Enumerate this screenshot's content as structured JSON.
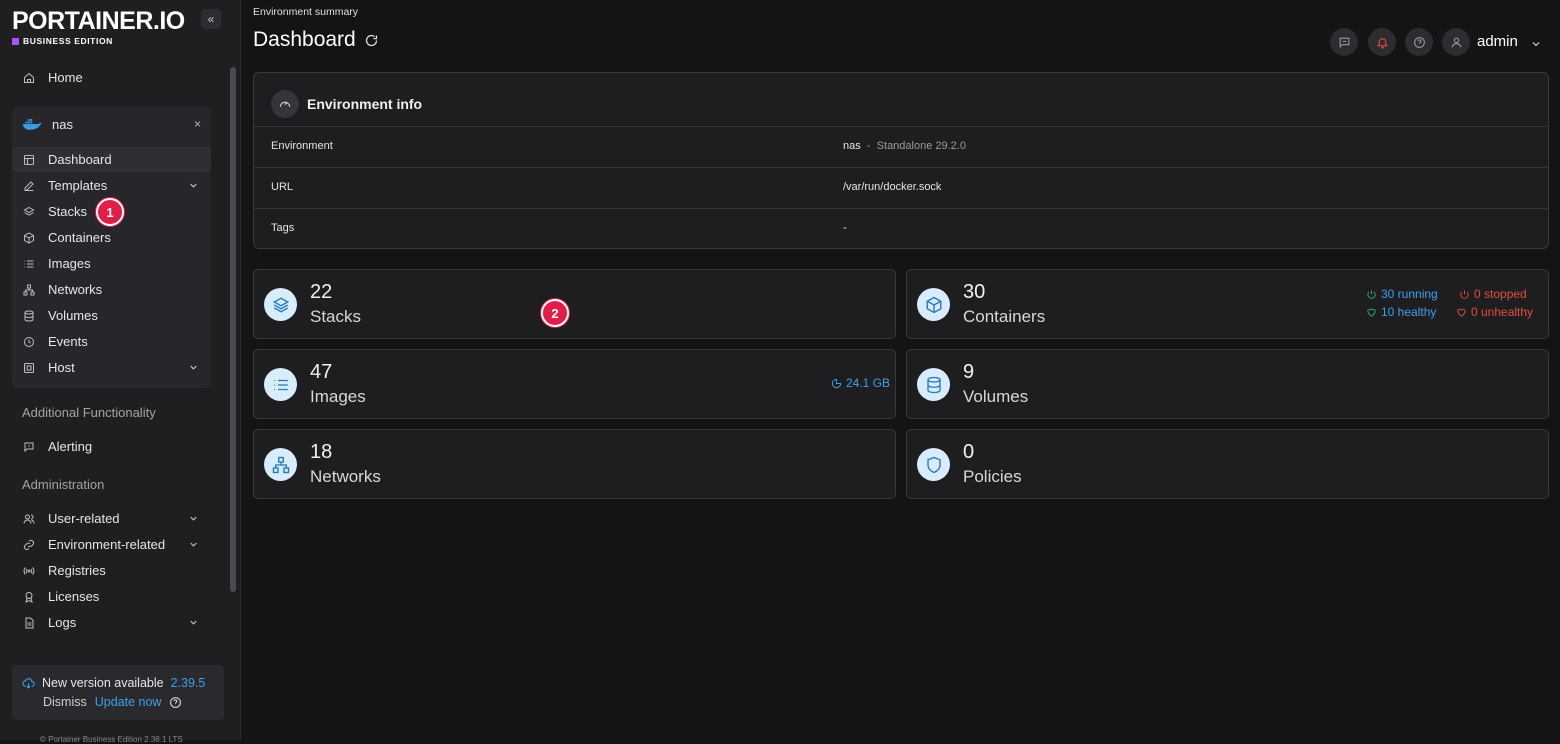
{
  "brand": {
    "name": "PORTAINER.IO",
    "edition": "BUSINESS EDITION",
    "edition_color": "#a855f7"
  },
  "sidebar": {
    "home": "Home",
    "environment": {
      "name": "nas",
      "close": "×"
    },
    "env_items": [
      {
        "label": "Dashboard",
        "icon": "dashboard-icon"
      },
      {
        "label": "Templates",
        "icon": "edit-icon"
      },
      {
        "label": "Stacks",
        "icon": "layers-icon"
      },
      {
        "label": "Containers",
        "icon": "box-icon"
      },
      {
        "label": "Images",
        "icon": "list-icon"
      },
      {
        "label": "Networks",
        "icon": "network-icon"
      },
      {
        "label": "Volumes",
        "icon": "database-icon"
      },
      {
        "label": "Events",
        "icon": "clock-icon"
      },
      {
        "label": "Host",
        "icon": "server-icon"
      }
    ],
    "additional_label": "Additional Functionality",
    "alerting": "Alerting",
    "administration_label": "Administration",
    "admin_items": [
      {
        "label": "User-related"
      },
      {
        "label": "Environment-related"
      },
      {
        "label": "Registries"
      },
      {
        "label": "Licenses"
      },
      {
        "label": "Logs"
      }
    ],
    "update": {
      "text": "New version available",
      "version": "2.39.5",
      "dismiss": "Dismiss",
      "update_now": "Update now"
    },
    "footer": "© Portainer Business Edition 2.38.1 LTS"
  },
  "header": {
    "breadcrumb": "Environment summary",
    "title": "Dashboard",
    "user": "admin"
  },
  "env_info": {
    "title": "Environment info",
    "rows": [
      {
        "key": "Environment",
        "name": "nas",
        "sep": "-",
        "detail": "Standalone 29.2.0"
      },
      {
        "key": "URL",
        "value": "/var/run/docker.sock"
      },
      {
        "key": "Tags",
        "value": "-"
      }
    ]
  },
  "stats": {
    "stacks": {
      "count": "22",
      "label": "Stacks"
    },
    "containers": {
      "count": "30",
      "label": "Containers",
      "running": "30 running",
      "stopped": "0 stopped",
      "healthy": "10 healthy",
      "unhealthy": "0 unhealthy"
    },
    "images": {
      "count": "47",
      "label": "Images",
      "size": "24.1 GB"
    },
    "volumes": {
      "count": "9",
      "label": "Volumes"
    },
    "networks": {
      "count": "18",
      "label": "Networks"
    },
    "policies": {
      "count": "0",
      "label": "Policies"
    }
  },
  "annotations": {
    "badge1": "1",
    "badge2": "2"
  },
  "colors": {
    "accent": "#3ea0e6",
    "danger": "#e04f3c",
    "badge": "#e11d48",
    "icon_bg": "#d9ecfb"
  }
}
